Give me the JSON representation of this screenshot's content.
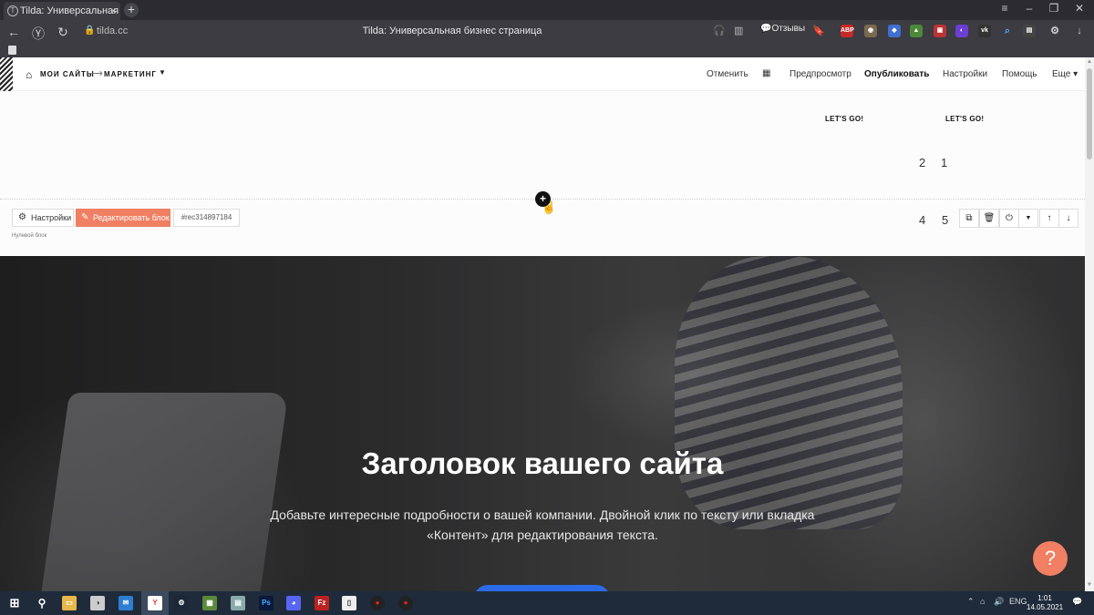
{
  "browser": {
    "tab_title": "Tilda: Универсальная б",
    "url": "tilda.cc",
    "page_title": "Tilda: Универсальная бизнес страница",
    "reviews_label": "Отзывы"
  },
  "topbar": {
    "breadcrumb_sites": "МОИ САЙТЫ",
    "breadcrumb_arrow": "⟶",
    "breadcrumb_project": "МАРКЕТИНГ",
    "menu": {
      "undo": "Отменить",
      "preview": "Предпросмотр",
      "publish": "Опубликовать",
      "settings": "Настройки",
      "help": "Помощь",
      "more": "Еще"
    }
  },
  "zero_block": {
    "lets_go_1": "LET'S GO!",
    "lets_go_2": "LET'S GO!",
    "numbers": [
      "2",
      "1",
      "4",
      "5"
    ],
    "settings_label": "Настройки",
    "edit_label": "Редактировать блок",
    "record_id": "#rec314897184",
    "block_name": "Нулевой блок"
  },
  "hero": {
    "title": "Заголовок вашего сайта",
    "subtitle": "Добавьте интересные подробности о вашей компании. Двойной клик по тексту или вкладка «Контент» для редактирования текста."
  },
  "taskbar": {
    "lang": "ENG",
    "time": "1:01",
    "date": "14.05.2021"
  },
  "colors": {
    "accent": "#f07f63",
    "hero_button": "#2c6be8",
    "taskbar": "#1f2b3a"
  }
}
